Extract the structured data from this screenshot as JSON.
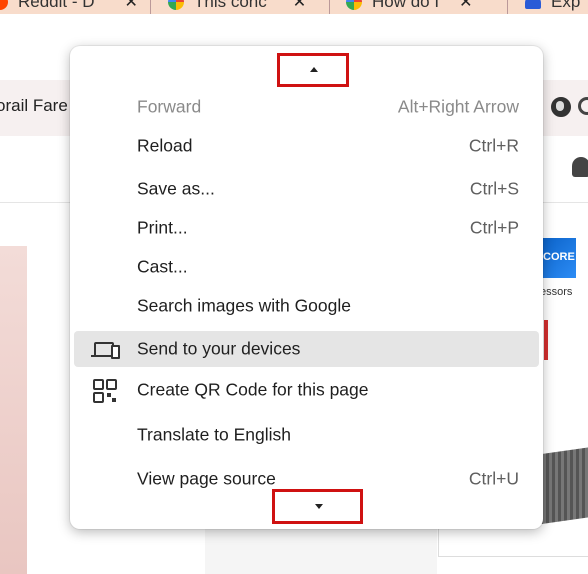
{
  "tabs": [
    {
      "icon": "reddit-icon",
      "label": "Reddit - D"
    },
    {
      "icon": "google-icon",
      "label": "This conc"
    },
    {
      "icon": "google-icon",
      "label": "How do I"
    },
    {
      "icon": "account-icon",
      "label": "Exp"
    }
  ],
  "tab_close_glyph": "✕",
  "bookmarks": {
    "label": "orail Fare"
  },
  "ad": {
    "badge": "CORE",
    "text": "essors"
  },
  "menu": {
    "scroll_up_glyph": "▲",
    "scroll_down_glyph": "▼",
    "items": [
      {
        "label": "Forward",
        "shortcut": "Alt+Right Arrow",
        "disabled": true
      },
      {
        "label": "Reload",
        "shortcut": "Ctrl+R"
      },
      {
        "label": "Save as...",
        "shortcut": "Ctrl+S"
      },
      {
        "label": "Print...",
        "shortcut": "Ctrl+P"
      },
      {
        "label": "Cast...",
        "shortcut": ""
      },
      {
        "label": "Search images with Google",
        "shortcut": ""
      },
      {
        "label": "Send to your devices",
        "shortcut": "",
        "icon": "devices-icon",
        "highlighted": true
      },
      {
        "label": "Create QR Code for this page",
        "shortcut": "",
        "icon": "qr-code-icon"
      },
      {
        "label": "Translate to English",
        "shortcut": ""
      },
      {
        "label": "View page source",
        "shortcut": "Ctrl+U"
      }
    ]
  },
  "colors": {
    "highlight_border": "#cf1111",
    "menu_highlight": "#e5e5e5",
    "tab_strip": "#f8dccb"
  }
}
